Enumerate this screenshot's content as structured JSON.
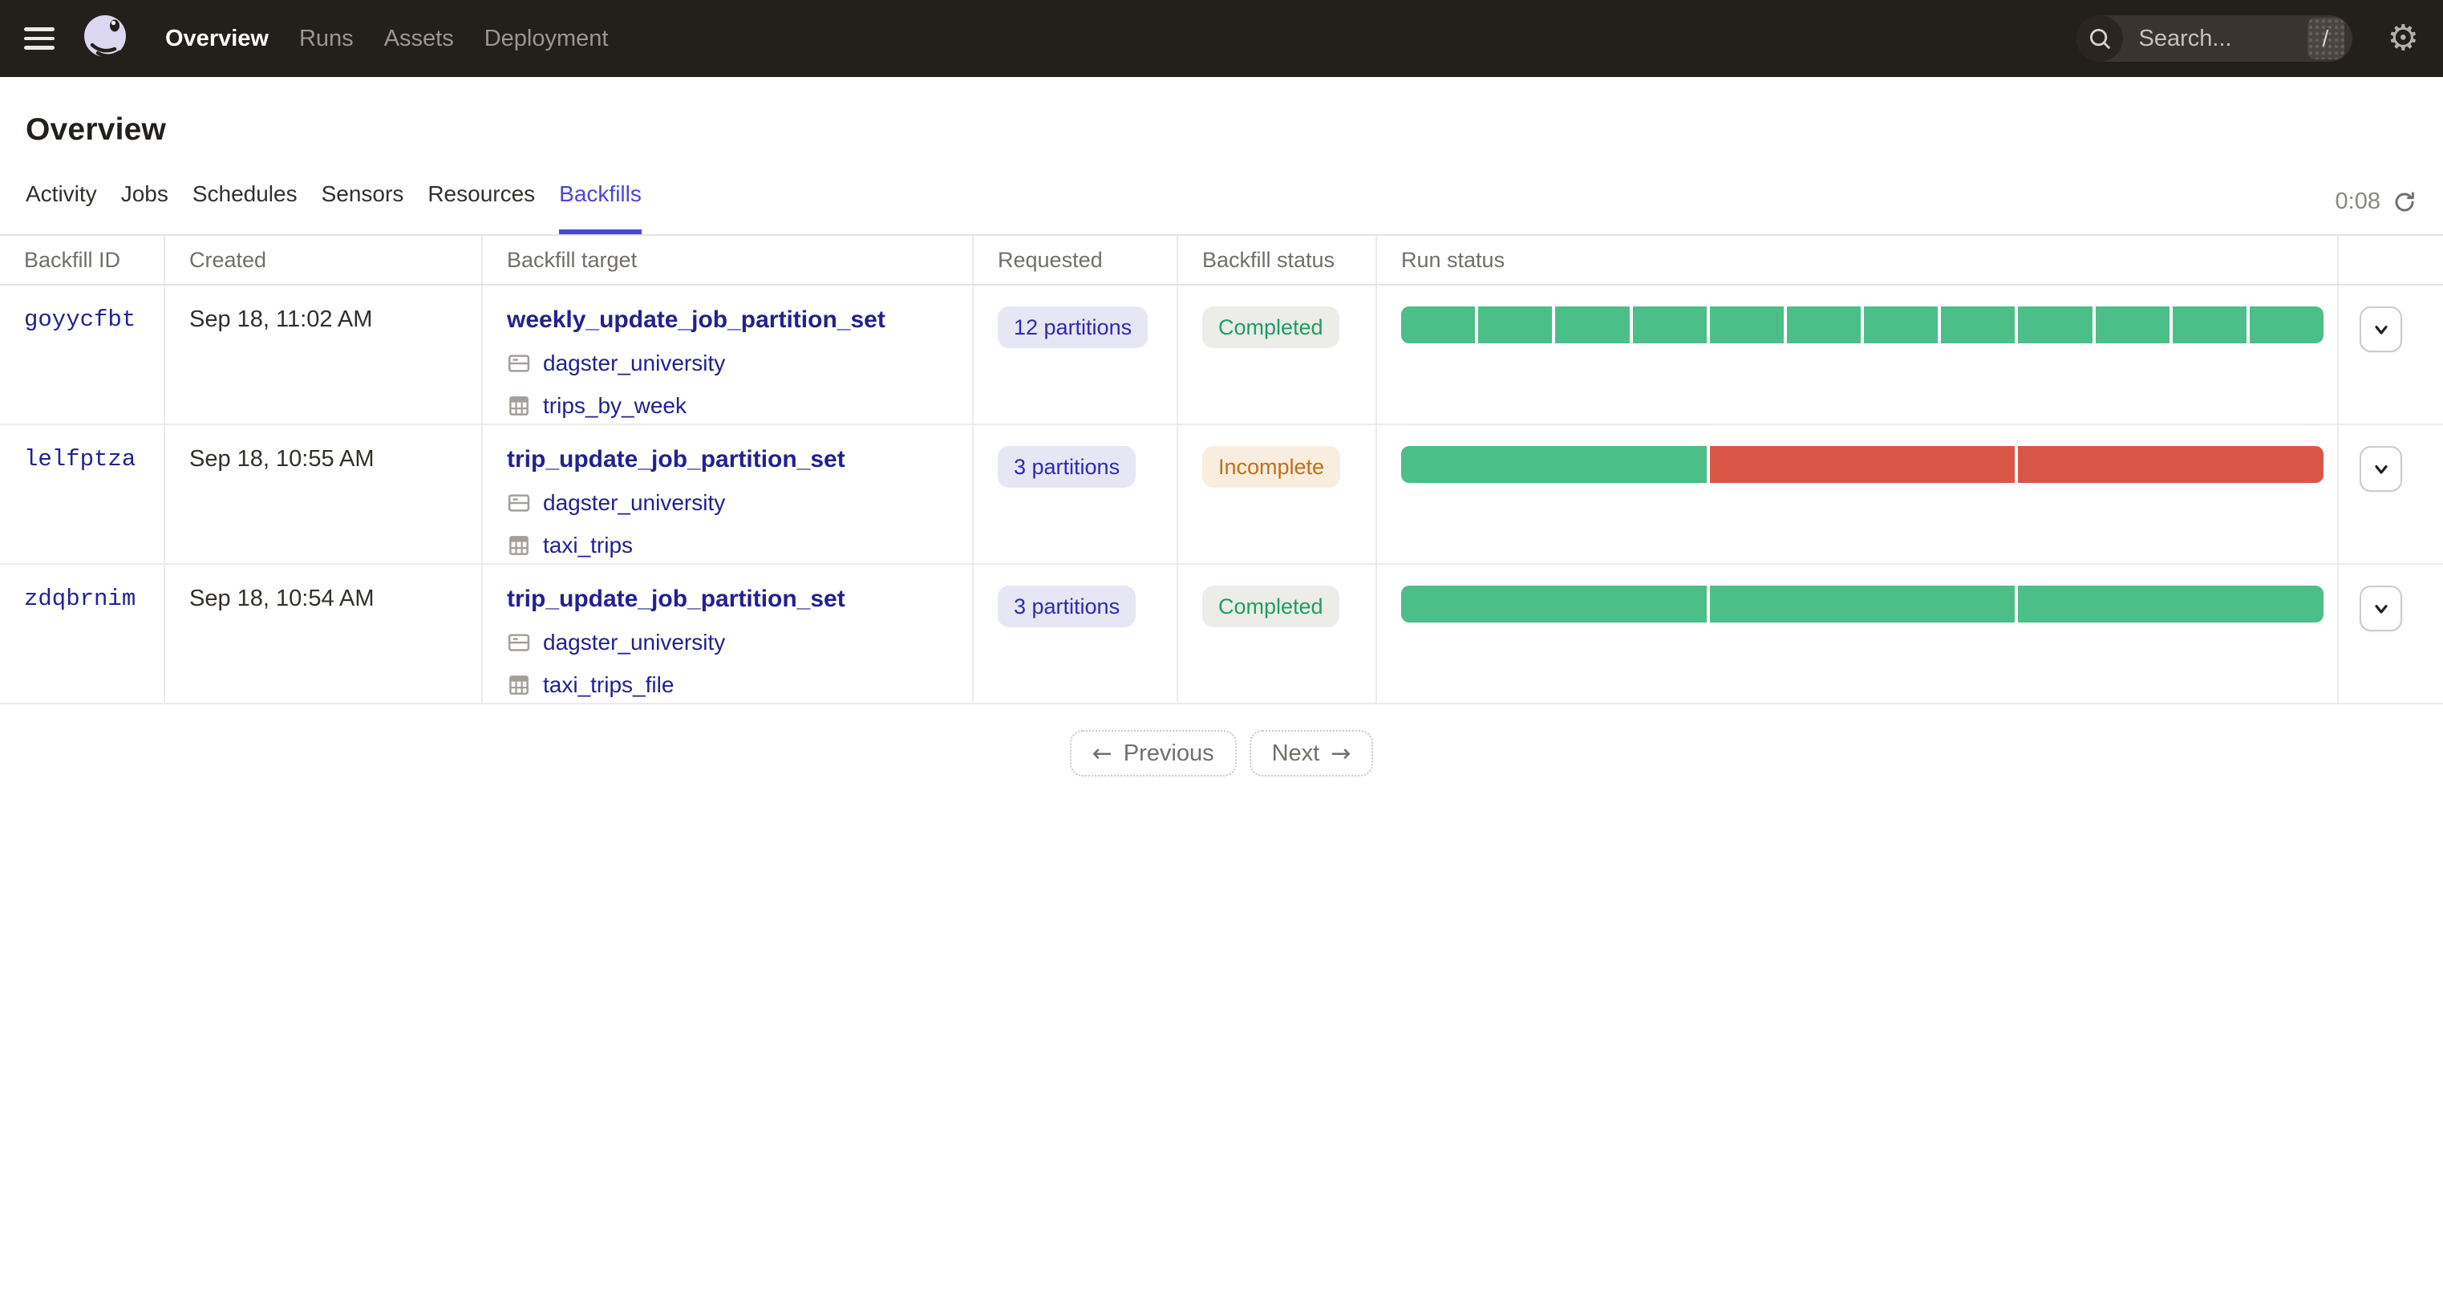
{
  "nav": {
    "items": [
      {
        "label": "Overview",
        "active": true
      },
      {
        "label": "Runs",
        "active": false
      },
      {
        "label": "Assets",
        "active": false
      },
      {
        "label": "Deployment",
        "active": false
      }
    ],
    "search_placeholder": "Search...",
    "search_shortcut": "/"
  },
  "page": {
    "title": "Overview"
  },
  "tabs": [
    {
      "label": "Activity",
      "active": false
    },
    {
      "label": "Jobs",
      "active": false
    },
    {
      "label": "Schedules",
      "active": false
    },
    {
      "label": "Sensors",
      "active": false
    },
    {
      "label": "Resources",
      "active": false
    },
    {
      "label": "Backfills",
      "active": true
    }
  ],
  "refresh": {
    "countdown": "0:08"
  },
  "table": {
    "columns": [
      "Backfill ID",
      "Created",
      "Backfill target",
      "Requested",
      "Backfill status",
      "Run status"
    ],
    "rows": [
      {
        "id": "goyycfbt",
        "created": "Sep 18, 11:02 AM",
        "target": "weekly_update_job_partition_set",
        "code_location": "dagster_university",
        "asset": "trips_by_week",
        "requested": "12 partitions",
        "status": "Completed",
        "status_kind": "success",
        "run_segments": [
          "success",
          "success",
          "success",
          "success",
          "success",
          "success",
          "success",
          "success",
          "success",
          "success",
          "success",
          "success"
        ]
      },
      {
        "id": "lelfptza",
        "created": "Sep 18, 10:55 AM",
        "target": "trip_update_job_partition_set",
        "code_location": "dagster_university",
        "asset": "taxi_trips",
        "requested": "3 partitions",
        "status": "Incomplete",
        "status_kind": "warning",
        "run_segments": [
          "success",
          "failure",
          "failure"
        ]
      },
      {
        "id": "zdqbrnim",
        "created": "Sep 18, 10:54 AM",
        "target": "trip_update_job_partition_set",
        "code_location": "dagster_university",
        "asset": "taxi_trips_file",
        "requested": "3 partitions",
        "status": "Completed",
        "status_kind": "success",
        "run_segments": [
          "success",
          "success",
          "success"
        ]
      }
    ]
  },
  "pagination": {
    "previous_label": "Previous",
    "previous_icon": "←",
    "next_label": "Next",
    "next_icon": "→"
  },
  "icons": {
    "menu": "hamburger-icon",
    "logo": "dagster-logo",
    "search": "magnifier-icon",
    "shortcut_key": "slash-key",
    "settings": "gear-icon",
    "refresh": "refresh-icon",
    "job": "job-folder-icon",
    "asset": "table-grid-icon",
    "expand": "chevron-down-icon"
  },
  "colors": {
    "success": "#4CBE88",
    "failure": "#D95747",
    "accent": "#4B45DB",
    "link": "#23218F",
    "nav_bg": "#231F1A"
  }
}
